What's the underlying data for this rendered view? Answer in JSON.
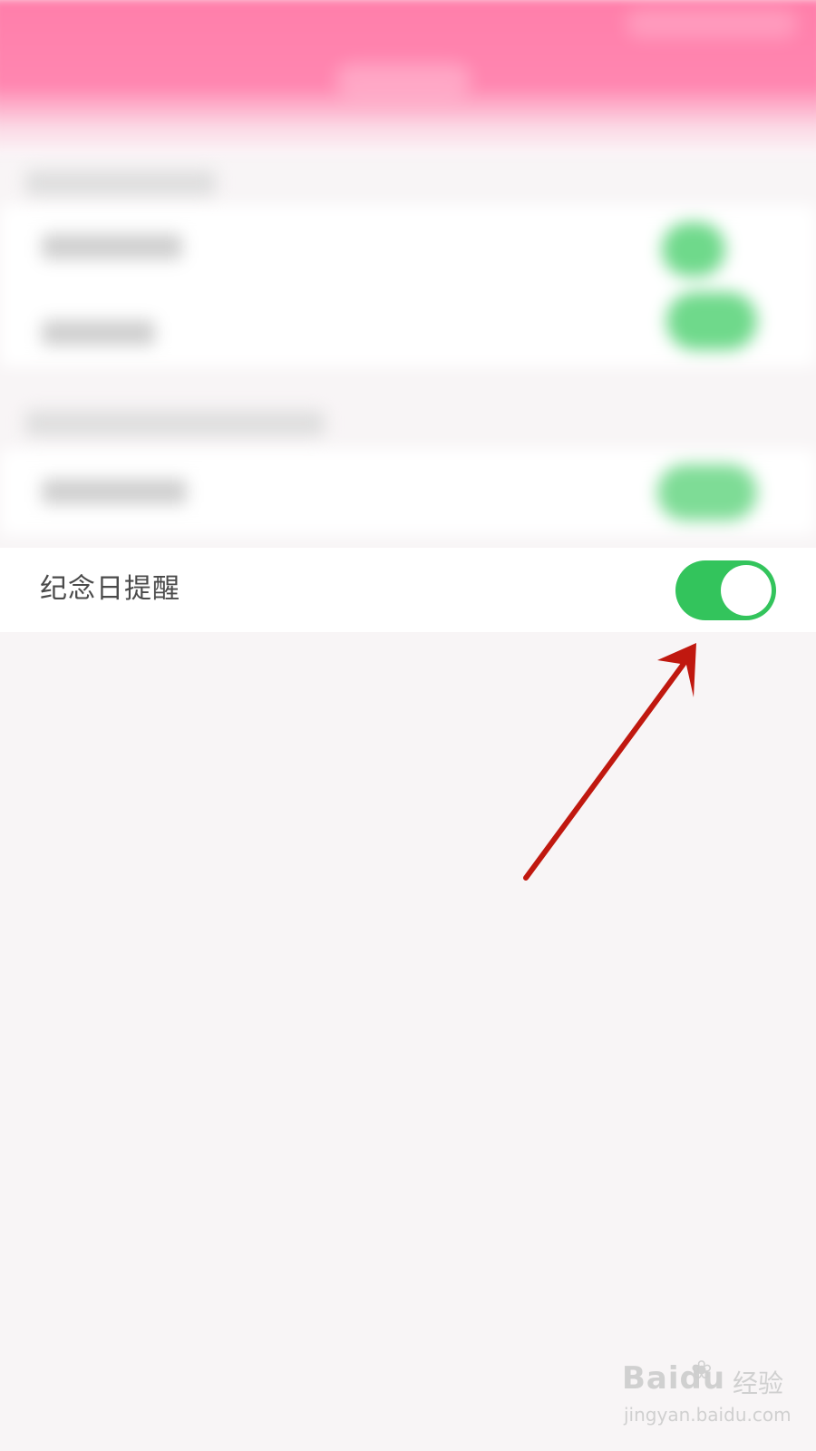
{
  "setting": {
    "label": "纪念日提醒",
    "enabled": true
  },
  "colors": {
    "header": "#ff7eaa",
    "toggle_on": "#33c45c",
    "arrow": "#c0180f",
    "background": "#f8f5f6"
  },
  "icons": {
    "annotation": "arrow-icon",
    "toggle": "toggle-switch-icon"
  },
  "watermark": {
    "logo": "Baidu",
    "brand_cn": "经验",
    "url": "jingyan.baidu.com"
  }
}
